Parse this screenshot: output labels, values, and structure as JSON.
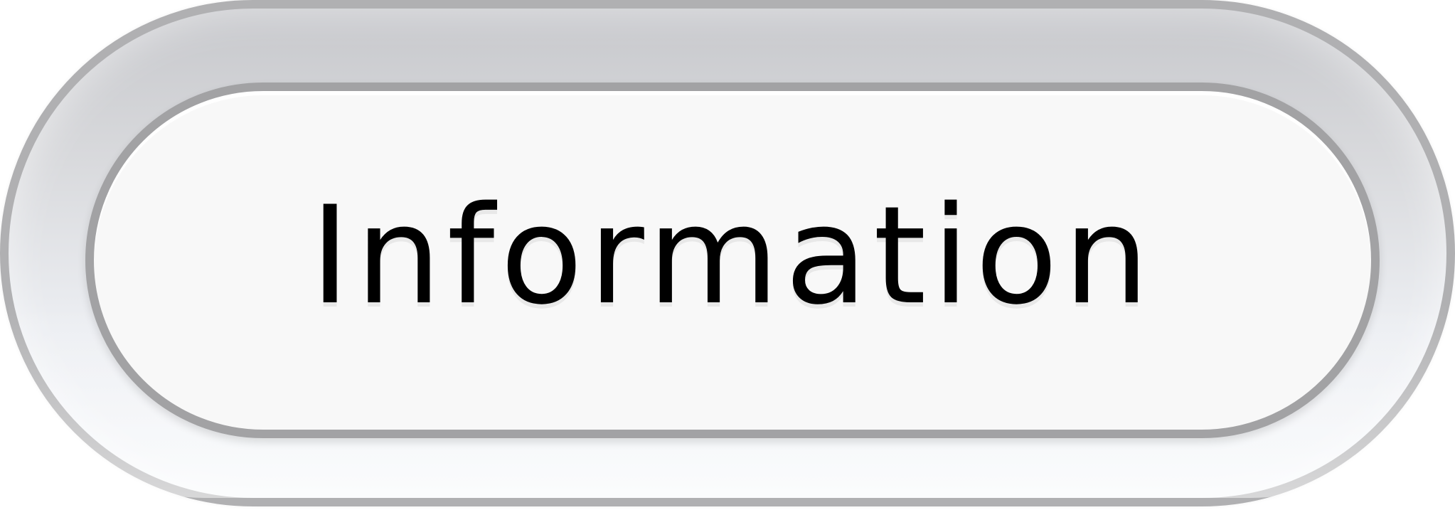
{
  "button": {
    "label": "Information"
  },
  "colors": {
    "outer_border": "#b0b0b2",
    "outer_top": "#c7c8cc",
    "outer_bottom": "#f6f8fb",
    "inner_border": "#a2a2a4",
    "inner_fill": "#f8f8f8",
    "text": "#000000"
  }
}
